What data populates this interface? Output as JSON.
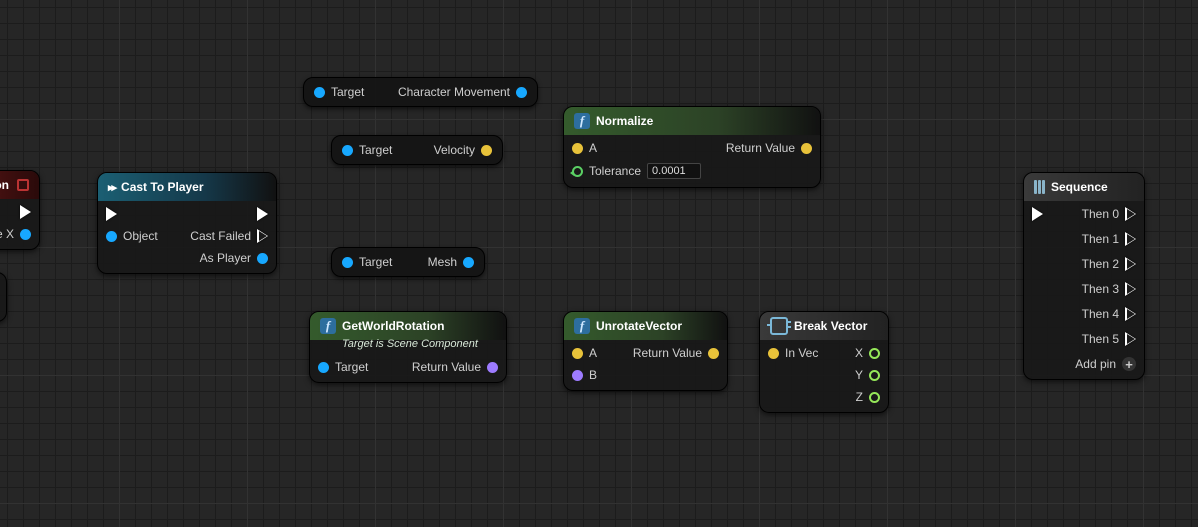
{
  "partial_event": {
    "title_fragment": "ion",
    "out_pin": "e X"
  },
  "cast": {
    "title": "Cast To Player",
    "object": "Object",
    "fail": "Cast Failed",
    "as": "As Player"
  },
  "compact": {
    "charMove": {
      "in": "Target",
      "out": "Character Movement"
    },
    "velocity": {
      "in": "Target",
      "out": "Velocity"
    },
    "mesh": {
      "in": "Target",
      "out": "Mesh"
    }
  },
  "normalize": {
    "title": "Normalize",
    "inA": "A",
    "tol": "Tolerance",
    "tolVal": "0.0001",
    "ret": "Return Value"
  },
  "getWorldRot": {
    "title": "GetWorldRotation",
    "subtitle": "Target is Scene Component",
    "target": "Target",
    "ret": "Return Value"
  },
  "unrotate": {
    "title": "UnrotateVector",
    "inA": "A",
    "inB": "B",
    "ret": "Return Value"
  },
  "breakVec": {
    "title": "Break Vector",
    "in": "In Vec",
    "x": "X",
    "y": "Y",
    "z": "Z"
  },
  "sequence": {
    "title": "Sequence",
    "pins": [
      "Then 0",
      "Then 1",
      "Then 2",
      "Then 3",
      "Then 4",
      "Then 5"
    ],
    "add": "Add pin"
  }
}
